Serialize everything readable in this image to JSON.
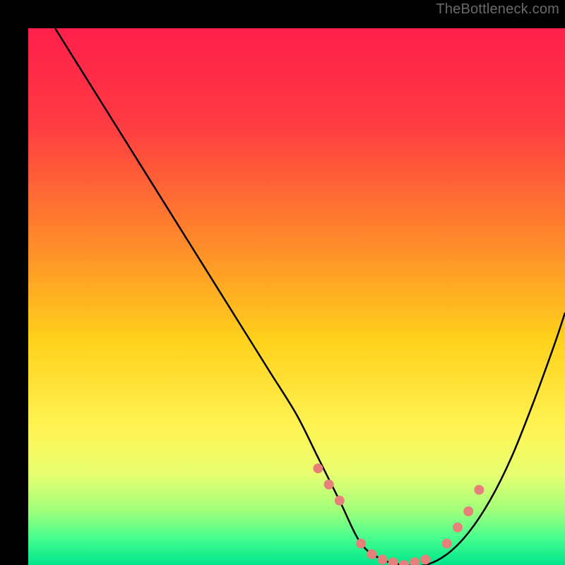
{
  "watermark": {
    "text": "TheBottleneck.com"
  },
  "chart_data": {
    "type": "line",
    "title": "",
    "xlabel": "",
    "ylabel": "",
    "xlim": [
      0,
      100
    ],
    "ylim": [
      0,
      100
    ],
    "grid": false,
    "legend": false,
    "background_gradient_stops": [
      {
        "pct": 0,
        "color": "#ff1f4b"
      },
      {
        "pct": 18,
        "color": "#ff3b42"
      },
      {
        "pct": 40,
        "color": "#ff8a2a"
      },
      {
        "pct": 58,
        "color": "#ffd11a"
      },
      {
        "pct": 75,
        "color": "#fff556"
      },
      {
        "pct": 83,
        "color": "#e8ff70"
      },
      {
        "pct": 90,
        "color": "#9fff7a"
      },
      {
        "pct": 95,
        "color": "#46ff8f"
      },
      {
        "pct": 100,
        "color": "#00e58a"
      }
    ],
    "series": [
      {
        "name": "bottleneck-curve",
        "color": "#000000",
        "x": [
          5,
          10,
          15,
          20,
          25,
          30,
          35,
          40,
          45,
          50,
          54,
          58,
          62,
          66,
          70,
          74,
          78,
          82,
          86,
          90,
          94,
          98,
          100
        ],
        "y": [
          100,
          92,
          84,
          76,
          68,
          60,
          52,
          44,
          36,
          28,
          20,
          12,
          4,
          1,
          0,
          0,
          2,
          6,
          12,
          20,
          30,
          41,
          47
        ]
      }
    ],
    "markers": {
      "name": "highlight-dots",
      "color": "#e77f7b",
      "radius": 7,
      "x": [
        54,
        56,
        58,
        62,
        64,
        66,
        68,
        70,
        72,
        74,
        78,
        80,
        82,
        84
      ],
      "y": [
        18,
        15,
        12,
        4,
        2,
        1,
        0.5,
        0,
        0.5,
        1,
        4,
        7,
        10,
        14
      ]
    }
  }
}
